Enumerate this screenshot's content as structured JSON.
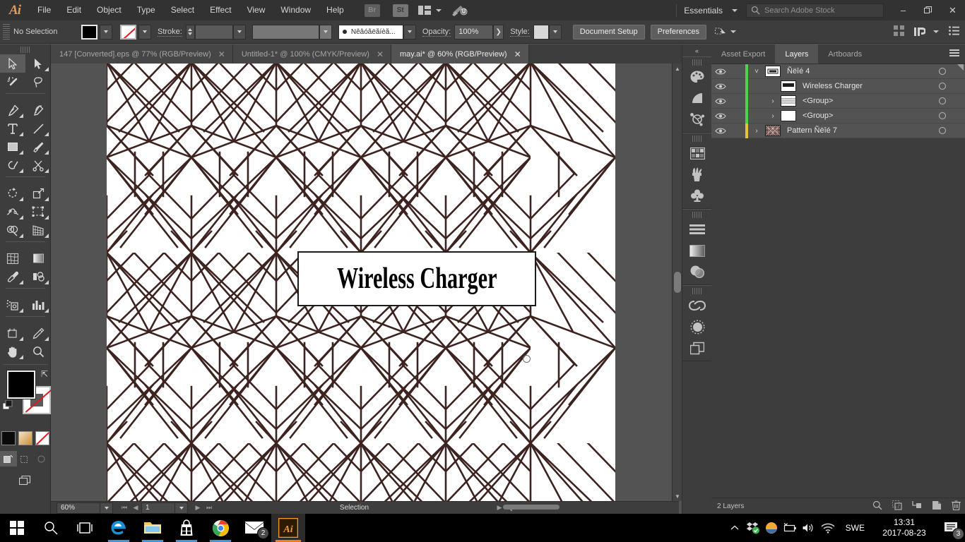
{
  "app": {
    "name": "Adobe Illustrator",
    "logo": "Ai"
  },
  "menubar": {
    "items": [
      "File",
      "Edit",
      "Object",
      "Type",
      "Select",
      "Effect",
      "View",
      "Window",
      "Help"
    ],
    "bridge_label": "Br",
    "stock_label": "St",
    "workspace": "Essentials",
    "search_placeholder": "Search Adobe Stock",
    "minimize": "–",
    "maximize": "❐",
    "close": "✕"
  },
  "controlbar": {
    "selection_status": "No Selection",
    "stroke_label": "Stroke:",
    "stroke_weight": "",
    "profile_value": "",
    "brush_value": "Ñêâóãëåíèå...",
    "opacity_label": "Opacity:",
    "opacity_value": "100%",
    "style_label": "Style:",
    "document_setup": "Document Setup",
    "preferences": "Preferences"
  },
  "tabs": [
    {
      "title": "147 [Converted].eps @ 77% (RGB/Preview)",
      "active": false
    },
    {
      "title": "Untitled-1* @ 100% (CMYK/Preview)",
      "active": false
    },
    {
      "title": "may.ai* @ 60% (RGB/Preview)",
      "active": true
    }
  ],
  "toolbar": {
    "tools": [
      "selection-tool",
      "direct-selection-tool",
      "magic-wand-tool",
      "lasso-tool",
      "pen-tool",
      "curvature-tool",
      "type-tool",
      "line-segment-tool",
      "rectangle-tool",
      "paintbrush-tool",
      "shaper-tool",
      "scissors-tool",
      "rotate-tool",
      "scale-tool",
      "width-tool",
      "free-transform-tool",
      "shape-builder-tool",
      "perspective-grid-tool",
      "mesh-tool",
      "gradient-tool",
      "eyedropper-tool",
      "blend-tool",
      "symbol-sprayer-tool",
      "column-graph-tool",
      "artboard-tool",
      "slice-tool",
      "hand-tool",
      "zoom-tool"
    ],
    "fill_color": "#000000",
    "stroke_color": "none",
    "mini_swatches": [
      "#000000",
      "#d9a55c",
      "none"
    ],
    "selected_tool": "selection-tool"
  },
  "artwork": {
    "title_text": "Wireless Charger",
    "pattern_line_color": "#3d2320",
    "background": "#ffffff"
  },
  "statusbar": {
    "zoom": "60%",
    "page": "1",
    "status": "Selection"
  },
  "icondock": {
    "items": [
      "color-panel-icon",
      "color-guide-icon",
      "symbols-panel-icon",
      "swatches-panel-icon",
      "brushes-panel-icon",
      "graphic-styles-icon",
      "align-panel-icon",
      "gradient-panel-icon",
      "transparency-panel-icon",
      "libraries-panel-icon",
      "appearance-panel-icon",
      "artboards-panel-icon"
    ],
    "collapse_label": "«"
  },
  "panel": {
    "tabs": [
      {
        "label": "Asset Export",
        "active": false
      },
      {
        "label": "Layers",
        "active": true
      },
      {
        "label": "Artboards",
        "active": false
      }
    ],
    "layers": [
      {
        "name": "Ñëîé 4",
        "indent": 0,
        "color": "#4fd14f",
        "twisty": "down",
        "thumb": "text-thumb",
        "visible": true
      },
      {
        "name": "Wireless Charger",
        "indent": 1,
        "color": "#4fd14f",
        "twisty": "none",
        "thumb": "text-thumb",
        "visible": true
      },
      {
        "name": "<Group>",
        "indent": 1,
        "color": "#4fd14f",
        "twisty": "right",
        "thumb": "lines-thumb",
        "visible": true
      },
      {
        "name": "<Group>",
        "indent": 1,
        "color": "#4fd14f",
        "twisty": "right",
        "thumb": "blank-thumb",
        "visible": true
      },
      {
        "name": "Pattern Ñëîé 7",
        "indent": 0,
        "color": "#e8c13a",
        "twisty": "right",
        "thumb": "pattern-thumb",
        "visible": true
      }
    ],
    "footer_count": "2 Layers",
    "footer_icons": [
      "locate-object-icon",
      "make-clipping-mask-icon",
      "make-sublayer-icon",
      "new-layer-icon",
      "delete-layer-icon"
    ]
  },
  "taskbar": {
    "items": [
      "start-icon",
      "search-icon",
      "task-view-icon",
      "edge-icon",
      "file-explorer-icon",
      "store-icon",
      "chrome-icon",
      "mail-icon",
      "illustrator-icon"
    ],
    "mail_badge": "2",
    "tray_icons": [
      "show-hidden-icons",
      "dropbox-icon",
      "onedrive-like-icon",
      "battery-icon",
      "volume-icon",
      "wifi-icon"
    ],
    "language": "SWE",
    "time": "13:31",
    "date": "2017-08-23",
    "action_center_badge": "3"
  }
}
